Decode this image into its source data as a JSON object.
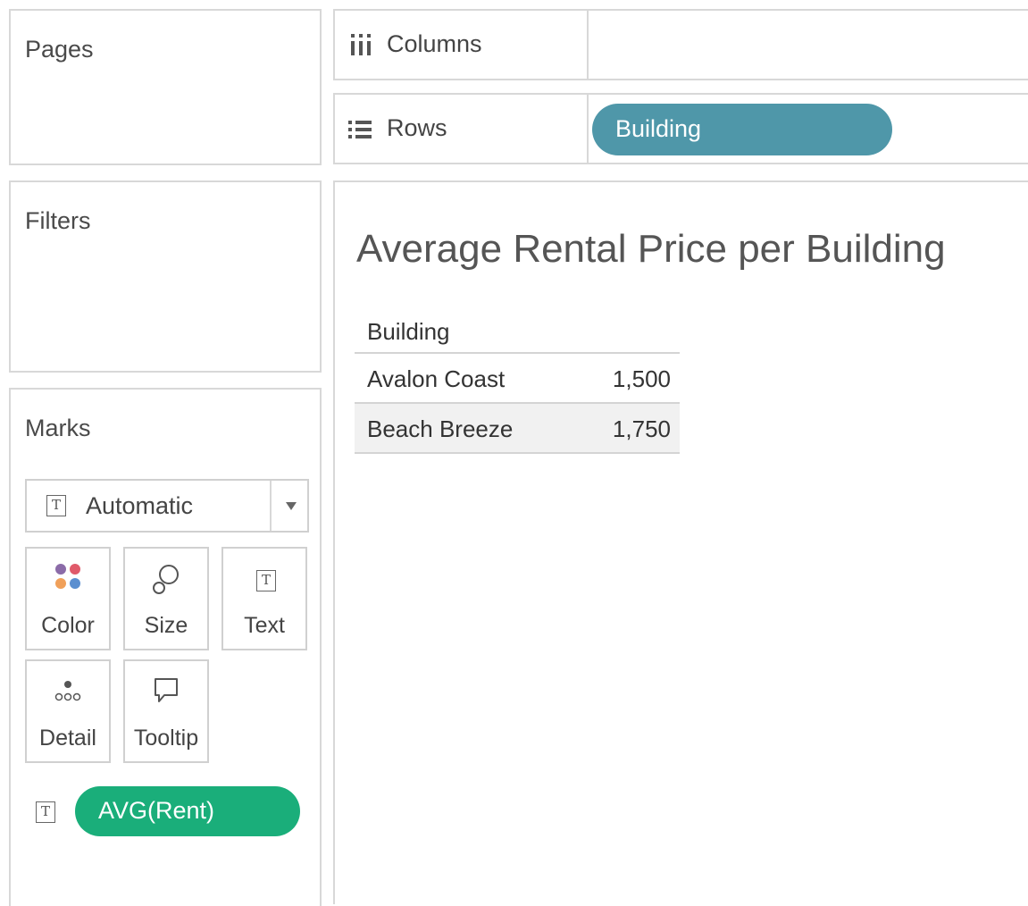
{
  "shelves": {
    "pages": {
      "title": "Pages"
    },
    "filters": {
      "title": "Filters"
    },
    "columns": {
      "label": "Columns",
      "pills": []
    },
    "rows": {
      "label": "Rows",
      "pills": [
        {
          "label": "Building",
          "color": "#4f97a9"
        }
      ]
    }
  },
  "marks": {
    "title": "Marks",
    "mark_type": {
      "value": "Automatic",
      "icon": "text-mark-icon"
    },
    "buttons": [
      {
        "label": "Color",
        "icon": "color-dots-icon"
      },
      {
        "label": "Size",
        "icon": "size-icon"
      },
      {
        "label": "Text",
        "icon": "text-mark-icon"
      },
      {
        "label": "Detail",
        "icon": "detail-icon"
      },
      {
        "label": "Tooltip",
        "icon": "tooltip-icon"
      }
    ],
    "fields": [
      {
        "label": "AVG(Rent)",
        "type_icon": "text-mark-icon",
        "color": "#1aae7a"
      }
    ]
  },
  "sheet": {
    "title": "Average Rental Price per Building",
    "table": {
      "header": "Building",
      "rows": [
        {
          "building": "Avalon Coast",
          "value": "1,500",
          "shaded": false
        },
        {
          "building": "Beach Breeze",
          "value": "1,750",
          "shaded": true
        }
      ]
    }
  },
  "colors": {
    "row_pill": "#4f97a9",
    "measure_pill": "#1aae7a",
    "panel_border": "#d8d8d8",
    "shaded_row": "#f1f1f1"
  }
}
